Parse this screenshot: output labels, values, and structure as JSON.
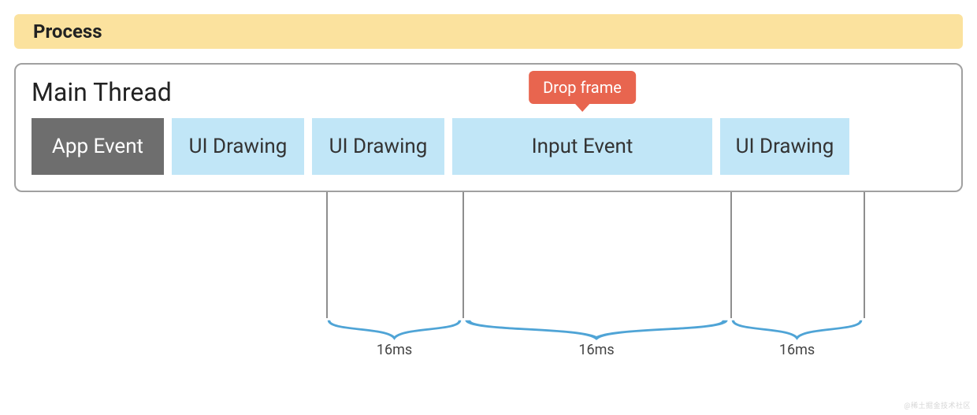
{
  "header": {
    "title": "Process"
  },
  "mainThread": {
    "title": "Main Thread",
    "blocks": [
      {
        "kind": "app",
        "label": "App Event"
      },
      {
        "kind": "ui",
        "label": "UI Drawing"
      },
      {
        "kind": "ui",
        "label": "UI Drawing"
      },
      {
        "kind": "input",
        "label": "Input Event",
        "badge": "Drop frame"
      },
      {
        "kind": "ui",
        "label": "UI Drawing"
      }
    ],
    "intervals": [
      {
        "label": "16ms"
      },
      {
        "label": "16ms"
      },
      {
        "label": "16ms"
      }
    ]
  },
  "watermark": "@稀土掘金技术社区"
}
